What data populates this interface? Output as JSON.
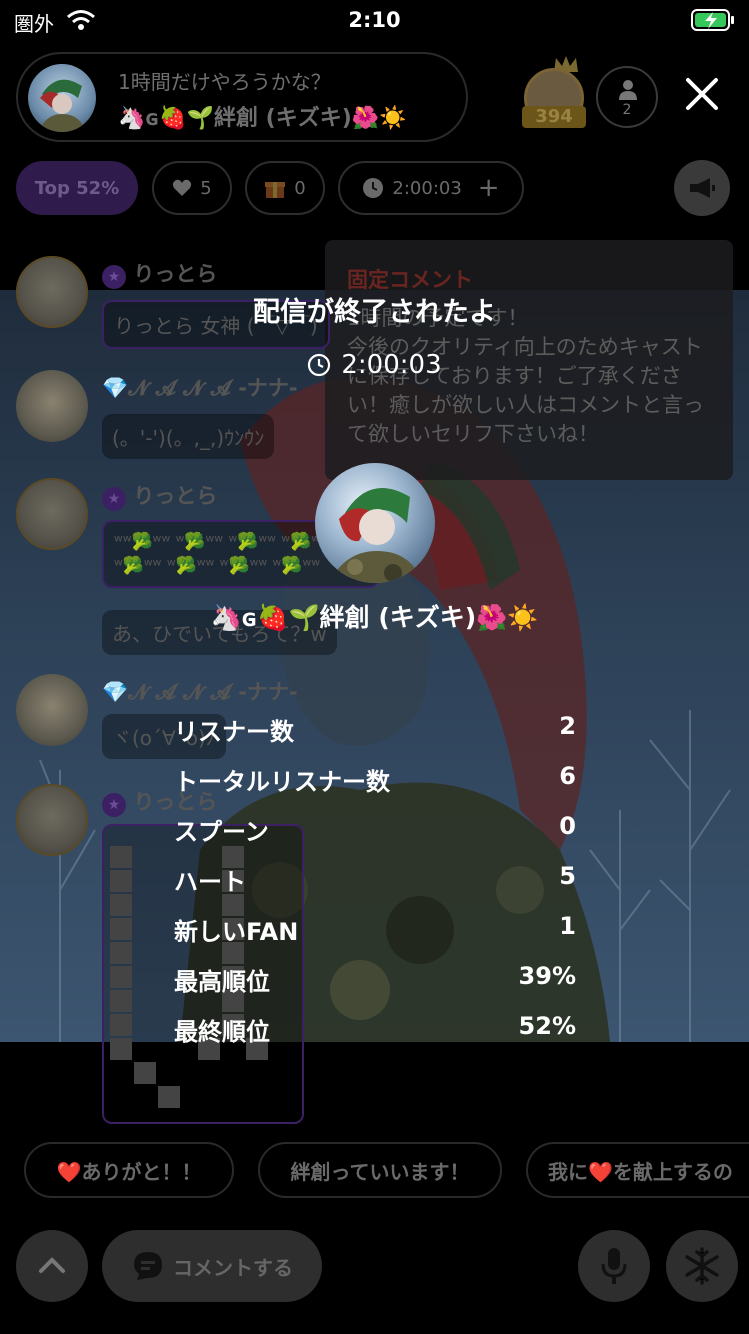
{
  "status_bar": {
    "carrier": "圏外",
    "time": "2:10"
  },
  "header": {
    "stream_title": "1時間だけやろうかな？",
    "host_name": "🦄ɢ🍓🌱絆創 (キズキ)🌺☀️",
    "rank_badge_value": "394",
    "listener_count": "2"
  },
  "stats_bar": {
    "top_rank": "Top 52%",
    "hearts": "5",
    "gifts": "0",
    "timer": "2:00:03"
  },
  "pinned_comment": {
    "title": "固定コメント",
    "body": "1時間の予定です！\n今後のクオリティ向上のためキャストに保存しております！ご了承ください！癒しが欲しい人はコメントと言って欲しいセリフ下さいね！"
  },
  "chat": [
    {
      "name": "りっとら",
      "text": "りっとら 女神 (￣▽￣)"
    },
    {
      "name": "💎𝓝 𝓐 𝓝 𝓐 -ナナ-",
      "text": "(。'-')(。,_,)ｳﾝｳﾝ"
    },
    {
      "name": "りっとら",
      "text": "ʷʷ🥦ʷʷ ʷ🥦ʷʷ ʷ🥦ʷʷ ʷ🥦ʷʷ🥦ʷʷ\nʷ🥦ʷʷ ʷ🥦ʷʷ ʷ🥦ʷʷ ʷ🥦ʷʷ"
    },
    {
      "name": "",
      "text": "あ、ひでいてもろて？w"
    },
    {
      "name": "💎𝓝 𝓐 𝓝 𝓐 -ナナ-",
      "text": "ヾ(o´∀`o)ﾉ"
    },
    {
      "name": "りっとら",
      "text": ""
    }
  ],
  "end_screen": {
    "title": "配信が終了されたよ",
    "duration": "2:00:03",
    "host_name": "🦄ɢ🍓🌱絆創 (キズキ)🌺☀️",
    "stats": [
      {
        "label": "リスナー数",
        "value": "2"
      },
      {
        "label": "トータルリスナー数",
        "value": "6"
      },
      {
        "label": "スプーン",
        "value": "0"
      },
      {
        "label": "ハート",
        "value": "5"
      },
      {
        "label": "新しいFAN",
        "value": "1"
      },
      {
        "label": "最高順位",
        "value": "39%"
      },
      {
        "label": "最終順位",
        "value": "52%"
      }
    ]
  },
  "quick_replies": [
    "❤️ありがと！！",
    "絆創っていいます！",
    "我に❤️を献上するの"
  ],
  "bottom_bar": {
    "comment_label": "コメントする"
  },
  "colors": {
    "accent_purple": "#2f1b4c",
    "badge_gold": "#6b5519"
  }
}
